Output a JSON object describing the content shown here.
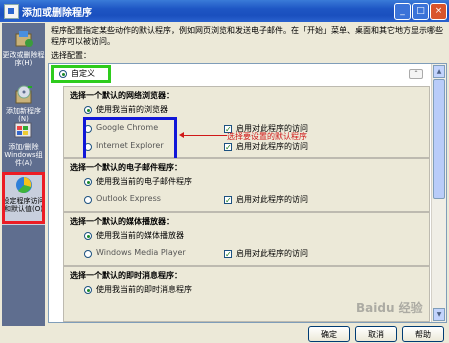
{
  "window": {
    "title": "添加或删除程序",
    "minimize": "_",
    "maximize": "□",
    "close": "×"
  },
  "sidebar": {
    "items": [
      {
        "label": "更改或删除程序(H)",
        "icon": "program-box-icon"
      },
      {
        "label": "添加新程序(N)",
        "icon": "cd-box-icon"
      },
      {
        "label": "添加/删除Windows组件(A)",
        "icon": "windows-components-icon"
      },
      {
        "label": "设定程序访问和默认值(O)",
        "icon": "default-programs-icon"
      }
    ]
  },
  "main": {
    "description": "程序配置指定某些动作的默认程序，例如网页浏览和发送电子邮件。在「开始」菜单、桌面和其它地方显示哪些程序可以被访问。",
    "config_label": "选择配置：",
    "custom_label": "自定义",
    "expand_glyph": "⌃",
    "annotation": "选择要设置的默认程序",
    "groups": [
      {
        "title": "选择一个默认的网络浏览器：",
        "options": [
          {
            "label": "使用我当前的浏览器",
            "selected": true,
            "show_check": false
          },
          {
            "label": "Google Chrome",
            "selected": false,
            "show_check": true,
            "check_label": "启用对此程序的访问"
          },
          {
            "label": "Internet Explorer",
            "selected": false,
            "show_check": true,
            "check_label": "启用对此程序的访问"
          }
        ]
      },
      {
        "title": "选择一个默认的电子邮件程序：",
        "options": [
          {
            "label": "使用我当前的电子邮件程序",
            "selected": true,
            "show_check": false
          },
          {
            "label": "Outlook Express",
            "selected": false,
            "show_check": true,
            "check_label": "启用对此程序的访问"
          }
        ]
      },
      {
        "title": "选择一个默认的媒体播放器：",
        "options": [
          {
            "label": "使用我当前的媒体播放器",
            "selected": true,
            "show_check": false
          },
          {
            "label": "Windows Media Player",
            "selected": false,
            "show_check": true,
            "check_label": "启用对此程序的访问"
          }
        ]
      },
      {
        "title": "选择一个默认的即时消息程序：",
        "options": [
          {
            "label": "使用我当前的即时消息程序",
            "selected": true,
            "show_check": false
          }
        ]
      }
    ]
  },
  "buttons": {
    "ok": "确定",
    "cancel": "取消",
    "help": "帮助"
  },
  "watermark": "Baidu 经验",
  "colors": {
    "titlebar": "#1e56c4",
    "sidebar": "#5f6e8f",
    "highlight_red": "#ec1c24",
    "highlight_green": "#2ecc1d",
    "highlight_blue": "#1016d8"
  }
}
